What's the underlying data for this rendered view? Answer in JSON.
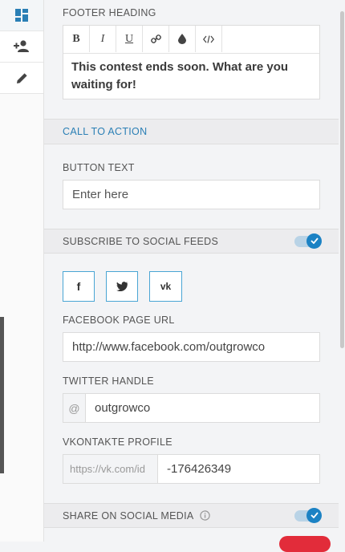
{
  "rail": {
    "items": [
      "dashboard-icon",
      "add-user-icon",
      "pencil-icon"
    ]
  },
  "footer": {
    "heading_label": "FOOTER HEADING",
    "toolbar": [
      "B",
      "I",
      "U",
      "link",
      "drop",
      "code"
    ],
    "text": "This contest ends soon. What are you waiting for!"
  },
  "cta": {
    "section_title": "CALL TO ACTION",
    "button_text_label": "BUTTON TEXT",
    "button_text_placeholder": "Enter here"
  },
  "subscribe": {
    "section_title": "SUBSCRIBE TO SOCIAL FEEDS",
    "enabled": true
  },
  "social": {
    "facebook_glyph": "f",
    "vk_glyph": "vk"
  },
  "facebook": {
    "label": "FACEBOOK PAGE URL",
    "value": "http://www.facebook.com/outgrowco"
  },
  "twitter": {
    "label": "TWITTER HANDLE",
    "prefix": "@",
    "value": "outgrowco"
  },
  "vk": {
    "label": "VKONTAKTE PROFILE",
    "prefix": "https://vk.com/id",
    "value": "-176426349"
  },
  "share": {
    "section_title": "SHARE ON SOCIAL MEDIA",
    "enabled": true
  },
  "colors": {
    "accent": "#1b82c4",
    "link": "#2a7fb5"
  }
}
